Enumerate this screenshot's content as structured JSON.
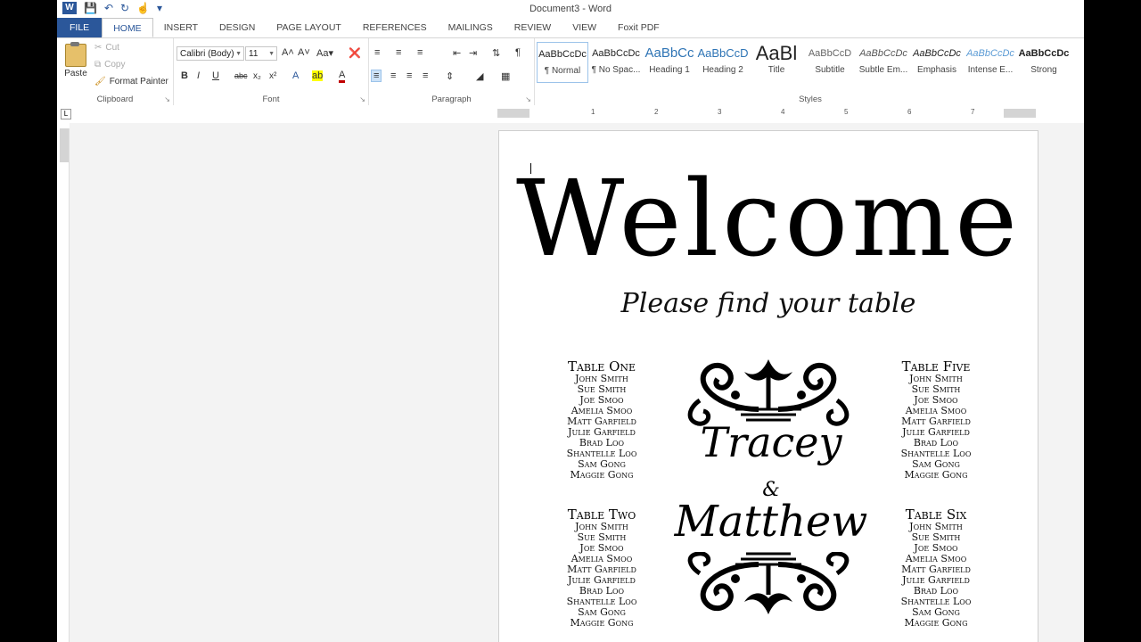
{
  "titlebar": {
    "doc_title": "Document3 - Word"
  },
  "tabs": [
    "FILE",
    "HOME",
    "INSERT",
    "DESIGN",
    "PAGE LAYOUT",
    "REFERENCES",
    "MAILINGS",
    "REVIEW",
    "VIEW",
    "Foxit PDF"
  ],
  "clipboard": {
    "paste": "Paste",
    "cut": "Cut",
    "copy": "Copy",
    "format_painter": "Format Painter",
    "label": "Clipboard"
  },
  "font": {
    "name": "Calibri (Body)",
    "size": "11",
    "label": "Font"
  },
  "paragraph": {
    "label": "Paragraph"
  },
  "styles": {
    "label": "Styles",
    "items": [
      {
        "sample": "AaBbCcDc",
        "name": "¶ Normal"
      },
      {
        "sample": "AaBbCcDc",
        "name": "¶ No Spac..."
      },
      {
        "sample": "AaBbCc",
        "name": "Heading 1"
      },
      {
        "sample": "AaBbCcD",
        "name": "Heading 2"
      },
      {
        "sample": "AaBl",
        "name": "Title"
      },
      {
        "sample": "AaBbCcD",
        "name": "Subtitle"
      },
      {
        "sample": "AaBbCcDc",
        "name": "Subtle Em..."
      },
      {
        "sample": "AaBbCcDc",
        "name": "Emphasis"
      },
      {
        "sample": "AaBbCcDc",
        "name": "Intense E..."
      },
      {
        "sample": "AaBbCcDc",
        "name": "Strong"
      }
    ]
  },
  "ruler": {
    "numbers": [
      "1",
      "2",
      "3",
      "4",
      "5",
      "6",
      "7"
    ]
  },
  "document": {
    "heading": "Welcome",
    "subheading": "Please find your table",
    "names_top": "Tracey",
    "ampersand": "&",
    "names_bottom": "Matthew",
    "tables": [
      {
        "title": "Table One",
        "guests": [
          "John Smith",
          "Sue Smith",
          "Joe Smoo",
          "Amelia Smoo",
          "Matt Garfield",
          "Julie Garfield",
          "Brad Loo",
          "Shantelle Loo",
          "Sam Gong",
          "Maggie Gong"
        ]
      },
      {
        "title": "Table Two",
        "guests": [
          "John Smith",
          "Sue Smith",
          "Joe Smoo",
          "Amelia Smoo",
          "Matt Garfield",
          "Julie Garfield",
          "Brad Loo",
          "Shantelle Loo",
          "Sam Gong",
          "Maggie Gong"
        ]
      },
      {
        "title": "Table Five",
        "guests": [
          "John Smith",
          "Sue Smith",
          "Joe Smoo",
          "Amelia Smoo",
          "Matt Garfield",
          "Julie Garfield",
          "Brad Loo",
          "Shantelle Loo",
          "Sam Gong",
          "Maggie Gong"
        ]
      },
      {
        "title": "Table Six",
        "guests": [
          "John Smith",
          "Sue Smith",
          "Joe Smoo",
          "Amelia Smoo",
          "Matt Garfield",
          "Julie Garfield",
          "Brad Loo",
          "Shantelle Loo",
          "Sam Gong",
          "Maggie Gong"
        ]
      }
    ]
  },
  "colors": {
    "accent": "#2b579a",
    "page_bg": "#ffffff",
    "canvas_bg": "#f3f3f3"
  }
}
